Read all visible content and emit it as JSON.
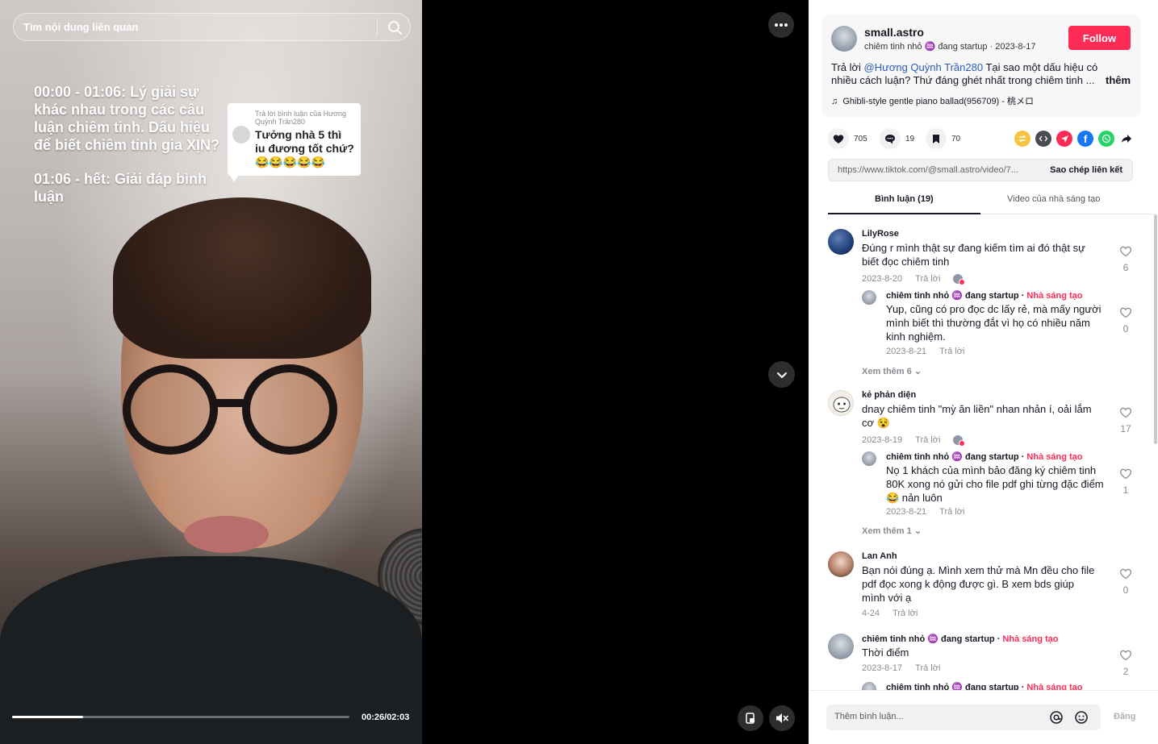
{
  "video": {
    "search_placeholder": "Tìm nội dung liên quan",
    "overlay_line1": "00:00 - 01:06: Lý giải sự khác nhau trong các câu luận chiêm tinh. Dấu hiệu để biết chiêm tinh gia XỊN?",
    "overlay_line2": "01:06 - hết: Giải đáp bình luận",
    "reply_card_label": "Trả lời bình luận của Hương Quỳnh Trần280",
    "reply_card_text": "Tưởng nhà 5 thì iu đương tốt chứ? 😂😂😂😂😂",
    "time": "00:26/02:03",
    "progress": 0.21
  },
  "controls": {
    "more_icon": "more-dots-icon",
    "down_icon": "chevron-down-icon",
    "miniplayer_icon": "miniplayer-icon",
    "mute_icon": "mute-icon"
  },
  "author": {
    "username": "small.astro",
    "subtitle": "chiêm tinh nhỏ ♒ đang startup · 2023-8-17",
    "follow_label": "Follow",
    "desc_prefix": "Trả lời ",
    "desc_mention": "@Hương Quỳnh Trần280",
    "desc_rest": " Tại sao một dấu hiệu có nhiều cách luận? Thứ đáng ghét nhất trong chiêm tinh ...",
    "more_label": "thêm",
    "music": "Ghibli-style gentle piano ballad(956709) - 桃メロ"
  },
  "actions": {
    "likes": "705",
    "comments": "19",
    "saves": "70"
  },
  "link": {
    "url": "https://www.tiktok.com/@small.astro/video/7...",
    "copy_label": "Sao chép liên kết"
  },
  "tabs": {
    "comments_label": "Bình luận (19)",
    "creator_videos_label": "Video của nhà sáng tạo"
  },
  "comments": [
    {
      "name": "LilyRose",
      "text": "Đúng r mình thật sự đang kiếm tìm ai đó thật sự biết đọc chiêm tinh",
      "date": "2023-8-20",
      "reply_label": "Trả lời",
      "likes": "6",
      "reply": {
        "name": "chiêm tinh nhỏ ♒ đang startup · ",
        "creator": "Nhà sáng tạo",
        "text": "Yup, cũng có pro đọc dc lấy rẻ, mà mấy người mình biết thì thường đắt vì họ có nhiều năm kinh nghiệm.",
        "date": "2023-8-21",
        "reply_label": "Trả lời",
        "likes": "0"
      },
      "see_more": "Xem thêm 6"
    },
    {
      "name": "kẻ phản diện",
      "text": "dnay chiêm tinh \"mỳ ăn liền\" nhan nhản í, oải lắm cơ 😵",
      "date": "2023-8-19",
      "reply_label": "Trả lời",
      "likes": "17",
      "reply": {
        "name": "chiêm tinh nhỏ ♒ đang startup · ",
        "creator": "Nhà sáng tạo",
        "text": "Nọ 1 khách của mình bảo đăng ký chiêm tinh 80K xong nó gửi cho file pdf ghi từng đặc điểm 😂 nản luôn",
        "date": "2023-8-21",
        "reply_label": "Trả lời",
        "likes": "1"
      },
      "see_more": "Xem thêm 1"
    },
    {
      "name": "Lan Anh",
      "text": "Bạn nói đúng ạ. Mình xem thử mà Mn đều cho file pdf đọc xong k động được gì. B xem bds giúp mình với ạ",
      "date": "4-24",
      "reply_label": "Trả lời",
      "likes": "0"
    },
    {
      "name": "chiêm tinh nhỏ ♒ đang startup · ",
      "creator": "Nhà sáng tạo",
      "text": "Thời điểm",
      "date": "2023-8-17",
      "reply_label": "Trả lời",
      "likes": "2"
    },
    {
      "name": "chiêm tinh nhỏ ♒ đang startup · ",
      "creator": "Nhà sáng tạo"
    }
  ],
  "footer": {
    "placeholder": "Thêm bình luận...",
    "post_label": "Đăng"
  },
  "colors": {
    "accent": "#fe2c55",
    "mention": "#2b5db9",
    "muted": "#8a8b91"
  }
}
